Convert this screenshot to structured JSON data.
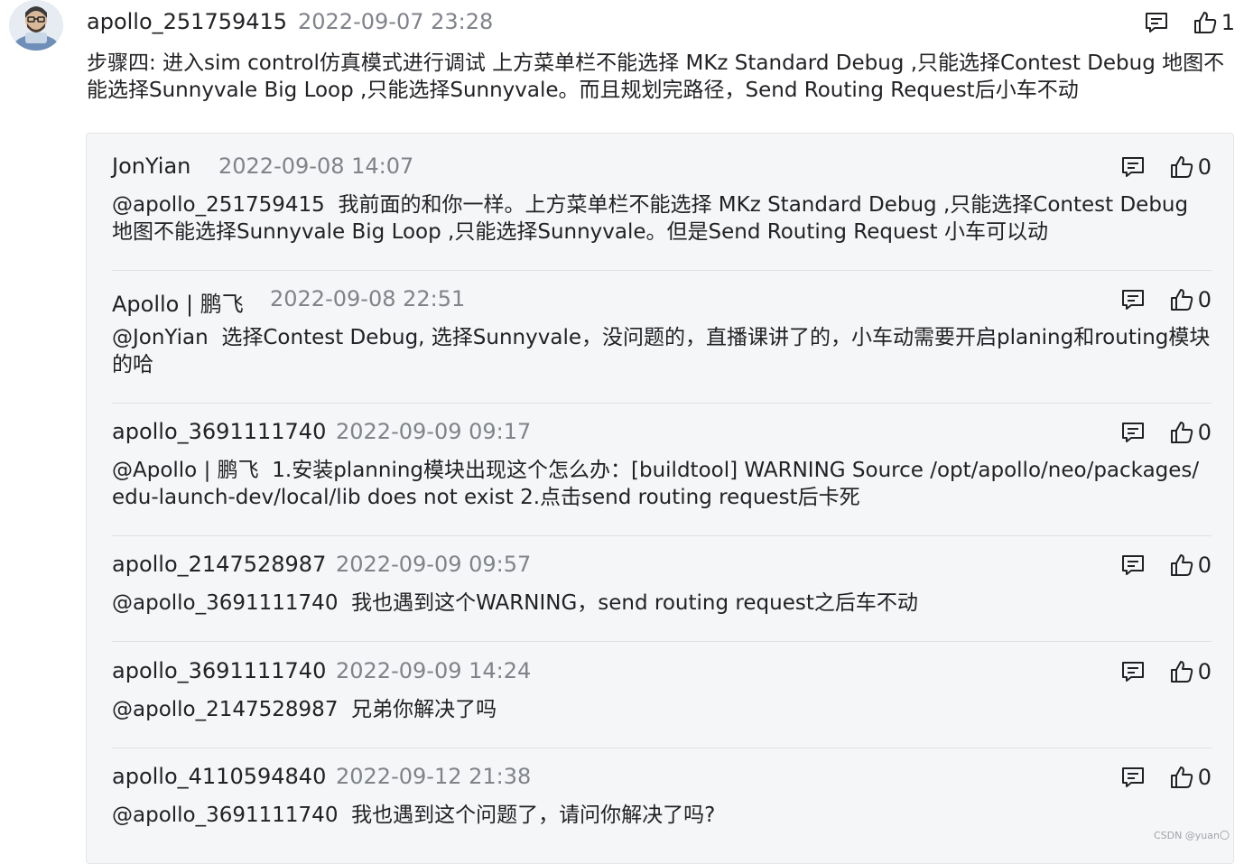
{
  "top_comment": {
    "username": "apollo_251759415",
    "time": "2022-09-07 23:28",
    "like_count": "1",
    "content": "步骤四: 进入sim control仿真模式进行调试 上方菜单栏不能选择 MKz Standard Debug ,只能选择Contest Debug 地图不能选择Sunnyvale Big Loop ,只能选择Sunnyvale。而且规划完路径，Send Routing Request后小车不动"
  },
  "replies": [
    {
      "username": "JonYian",
      "time": "2022-09-08 14:07",
      "like_count": "0",
      "mention": "@apollo_251759415",
      "content": "我前面的和你一样。上方菜单栏不能选择 MKz Standard Debug ,只能选择Contest Debug 地图不能选择Sunnyvale Big Loop ,只能选择Sunnyvale。但是Send Routing Request 小车可以动"
    },
    {
      "username": "Apollo | 鹏飞",
      "time": "2022-09-08 22:51",
      "like_count": "0",
      "mention": "@JonYian",
      "content": "选择Contest Debug, 选择Sunnyvale，没问题的，直播课讲了的，小车动需要开启planing和routing模块的哈"
    },
    {
      "username": "apollo_3691111740",
      "time": "2022-09-09 09:17",
      "like_count": "0",
      "mention": "@Apollo | 鹏飞",
      "content": "1.安装planning模块出现这个怎么办：[buildtool] WARNING Source /opt/apollo/neo/packages/edu-launch-dev/local/lib does not exist 2.点击send routing request后卡死"
    },
    {
      "username": "apollo_2147528987",
      "time": "2022-09-09 09:57",
      "like_count": "0",
      "mention": "@apollo_3691111740",
      "content": "我也遇到这个WARNING，send routing request之后车不动"
    },
    {
      "username": "apollo_3691111740",
      "time": "2022-09-09 14:24",
      "like_count": "0",
      "mention": "@apollo_2147528987",
      "content": "兄弟你解决了吗"
    },
    {
      "username": "apollo_4110594840",
      "time": "2022-09-12 21:38",
      "like_count": "0",
      "mention": "@apollo_3691111740",
      "content": "我也遇到这个问题了，请问你解决了吗?"
    }
  ],
  "icons": {
    "reply": "comment-icon",
    "like": "thumbs-up-icon",
    "avatar": "avatar-image"
  },
  "watermark": "CSDN @yuan〇"
}
